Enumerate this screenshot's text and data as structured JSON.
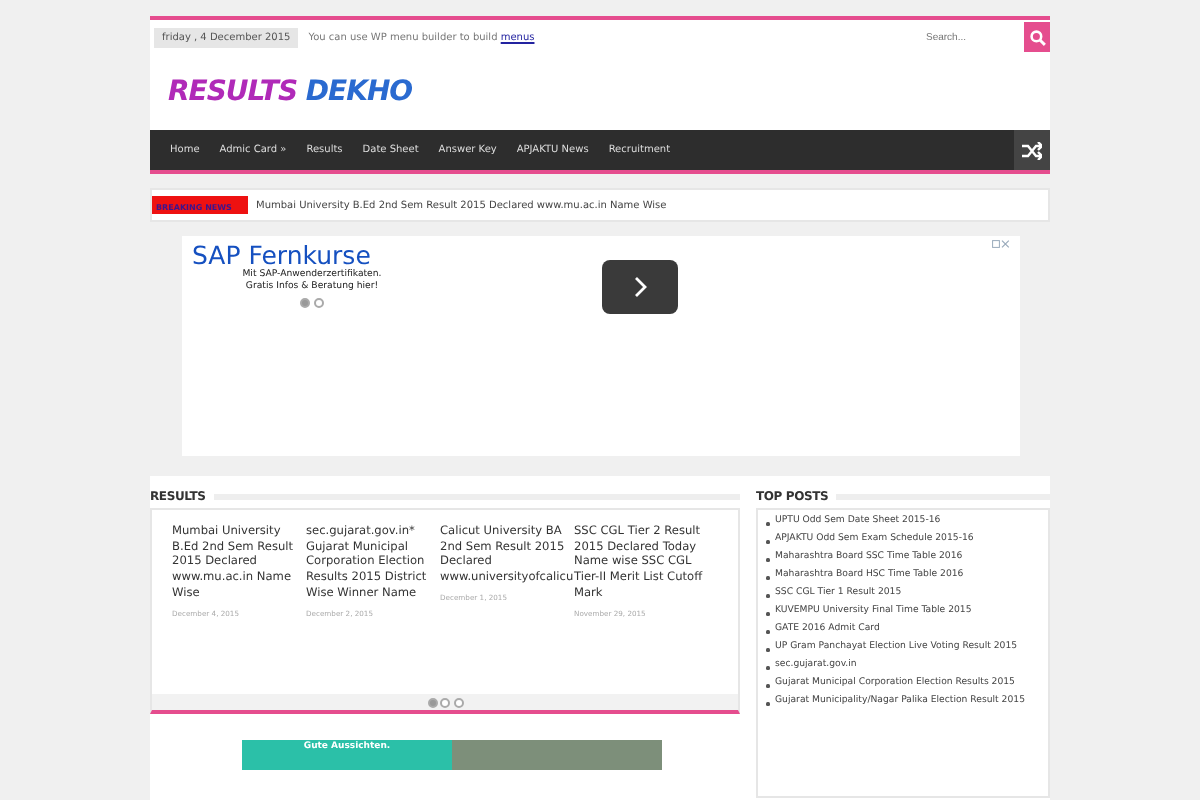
{
  "top_bar": {
    "date": "friday , 4 December 2015",
    "message": "You can use WP menu builder to build ",
    "message_link": "menus",
    "search": {
      "placeholder": "Search..."
    }
  },
  "logo": {
    "word_1": "RESULTS",
    "word_2": "DEKHO"
  },
  "nav": {
    "items": [
      {
        "label": "Home"
      },
      {
        "label": "Admic Card »"
      },
      {
        "label": "Results"
      },
      {
        "label": "Date Sheet"
      },
      {
        "label": "Answer Key"
      },
      {
        "label": "APJAKTU News"
      },
      {
        "label": "Recruitment"
      }
    ]
  },
  "breaking": {
    "label": "BREAKING NEWS",
    "text": "Mumbai University B.Ed 2nd Sem Result 2015 Declared www.mu.ac.in Name Wise"
  },
  "ad": {
    "title": "SAP Fernkurse",
    "line_1": "Mit SAP-Anwenderzertifikaten.",
    "line_2": "Gratis Infos & Beratung hier!",
    "dots": [
      {
        "selected": true
      },
      {
        "selected": false
      }
    ]
  },
  "results": {
    "title": "RESULTS",
    "cards": [
      {
        "title": "Mumbai University B.Ed 2nd Sem Result 2015 Declared www.mu.ac.in Name Wise",
        "date": "December 4, 2015"
      },
      {
        "title": "sec.gujarat.gov.in* Gujarat Municipal Corporation Election Results 2015 District Wise Winner Name",
        "date": "December 2, 2015"
      },
      {
        "title": "Calicut University BA 2nd Sem Result 2015 Declared www.universityofcalicu",
        "date": "December 1, 2015"
      },
      {
        "title": "SSC CGL Tier 2 Result 2015 Declared Today Name wise SSC CGL Tier-II Merit List Cutoff Mark",
        "date": "November 29, 2015"
      }
    ],
    "dots": [
      {
        "selected": true
      },
      {
        "selected": false
      },
      {
        "selected": false
      }
    ]
  },
  "top_posts": {
    "title": "TOP POSTS",
    "items": [
      "UPTU Odd Sem Date Sheet 2015-16",
      "APJAKTU Odd Sem Exam Schedule 2015-16",
      "Maharashtra Board SSC Time Table 2016",
      "Maharashtra Board HSC Time Table 2016",
      "SSC CGL Tier 1 Result 2015",
      "KUVEMPU University Final Time Table 2015",
      "GATE 2016 Admit Card",
      "UP Gram Panchayat Election Live Voting Result 2015",
      "sec.gujarat.gov.in",
      "Gujarat Municipal Corporation Election Results 2015",
      "Gujarat Municipality/Nagar Palika Election Result 2015"
    ]
  },
  "bottom_ad": {
    "text": "Gute Aussichten."
  }
}
